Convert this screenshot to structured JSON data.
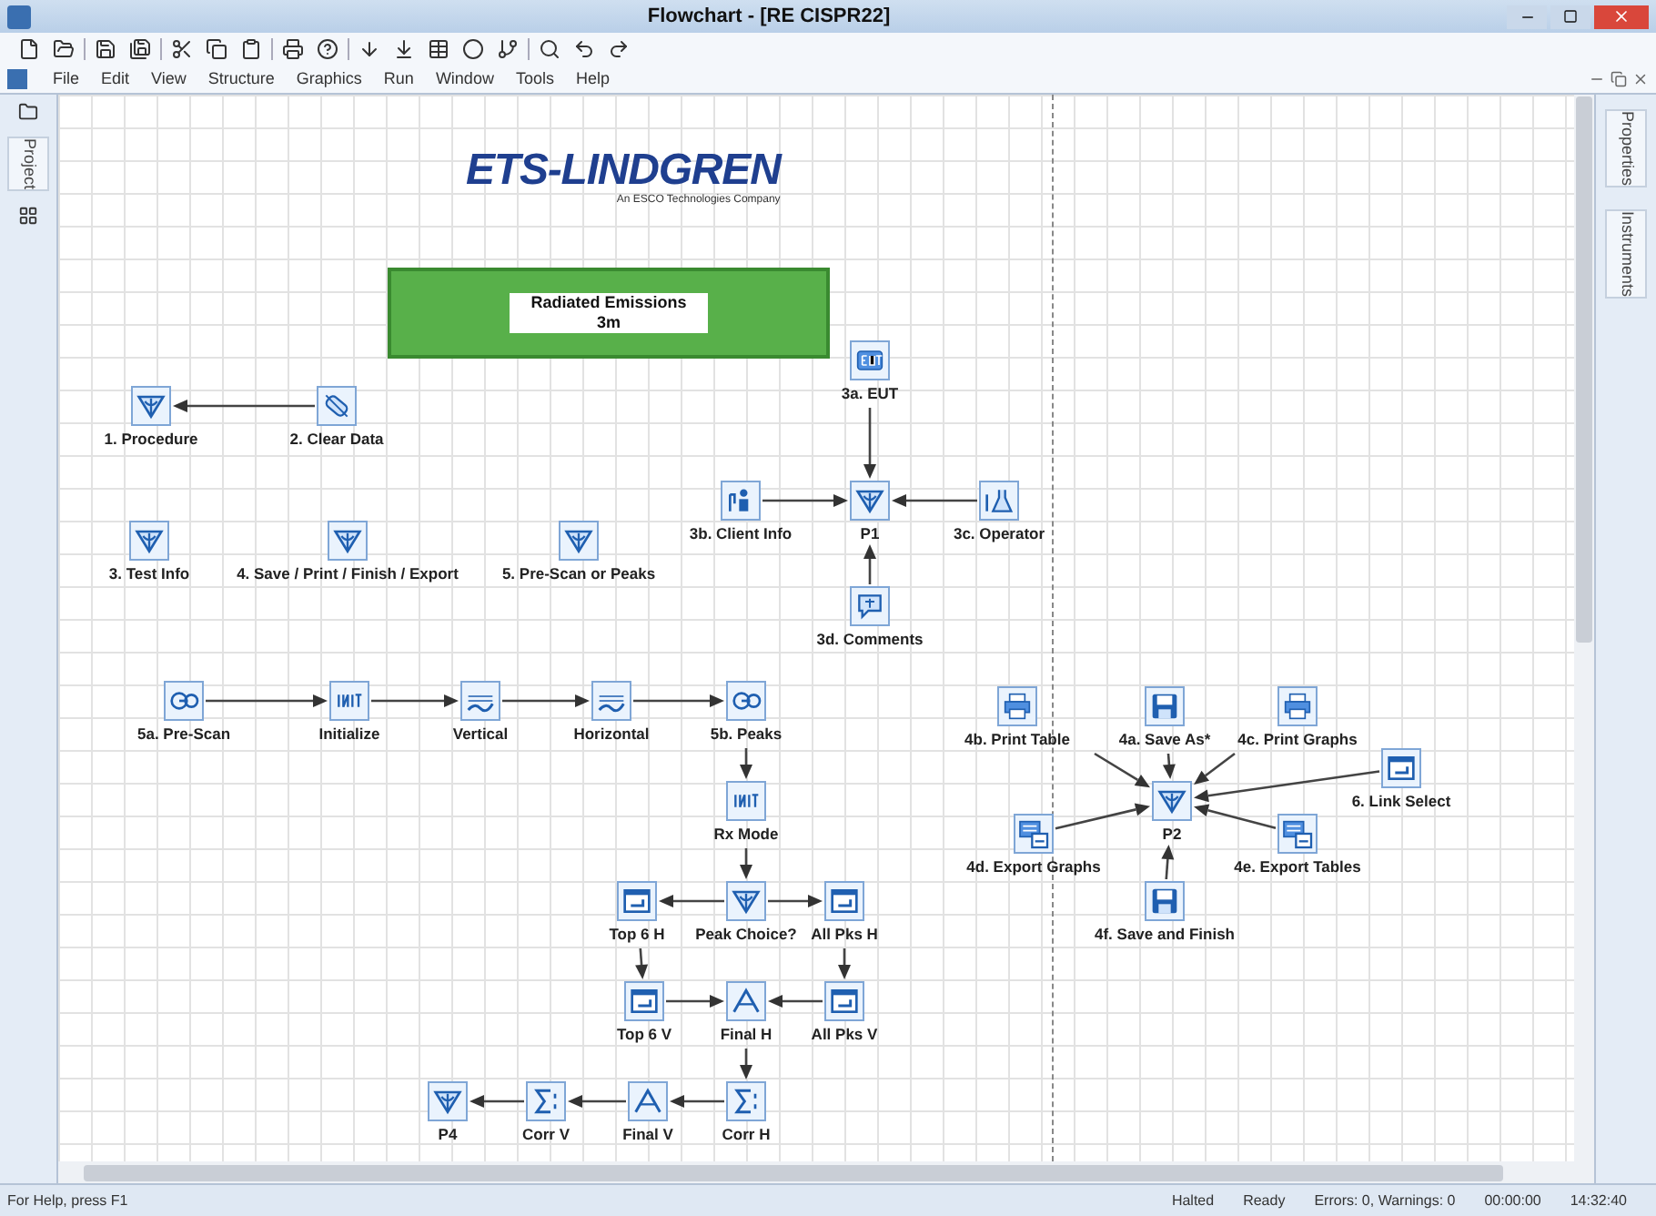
{
  "window": {
    "title": "Flowchart - [RE CISPR22]"
  },
  "menu": [
    {
      "label": "File"
    },
    {
      "label": "Edit"
    },
    {
      "label": "View"
    },
    {
      "label": "Structure"
    },
    {
      "label": "Graphics"
    },
    {
      "label": "Run"
    },
    {
      "label": "Window"
    },
    {
      "label": "Tools"
    },
    {
      "label": "Help"
    }
  ],
  "left_panel": {
    "tab": "Project"
  },
  "right_panel": {
    "tabs": [
      {
        "label": "Properties"
      },
      {
        "label": "Instruments"
      }
    ]
  },
  "canvas": {
    "logo": {
      "name": "ETS-LINDGREN",
      "tagline": "An ESCO Technologies Company"
    },
    "banner": {
      "title": "Radiated Emissions",
      "subtitle": "3m"
    },
    "nodes": [
      {
        "label": "1. Procedure",
        "kind": "decision"
      },
      {
        "label": "2. Clear Data",
        "kind": "clear"
      },
      {
        "label": "3a. EUT",
        "kind": "eut"
      },
      {
        "label": "3b. Client Info",
        "kind": "person"
      },
      {
        "label": "P1",
        "kind": "decision"
      },
      {
        "label": "3c. Operator",
        "kind": "flask"
      },
      {
        "label": "3d. Comments",
        "kind": "comments"
      },
      {
        "label": "3. Test Info",
        "kind": "decision"
      },
      {
        "label": "4. Save / Print / Finish / Export",
        "kind": "decision"
      },
      {
        "label": "5. Pre-Scan or Peaks",
        "kind": "decision"
      },
      {
        "label": "5a. Pre-Scan",
        "kind": "go"
      },
      {
        "label": "Initialize",
        "kind": "init"
      },
      {
        "label": "Vertical",
        "kind": "scan"
      },
      {
        "label": "Horizontal",
        "kind": "scan"
      },
      {
        "label": "5b. Peaks",
        "kind": "go"
      },
      {
        "label": "Rx Mode",
        "kind": "init"
      },
      {
        "label": "Top 6 H",
        "kind": "window"
      },
      {
        "label": "Peak Choice?",
        "kind": "decision"
      },
      {
        "label": "All Pks H",
        "kind": "window"
      },
      {
        "label": "Top 6 V",
        "kind": "window"
      },
      {
        "label": "Final H",
        "kind": "peak"
      },
      {
        "label": "All Pks V",
        "kind": "window"
      },
      {
        "label": "P4",
        "kind": "decision"
      },
      {
        "label": "Corr V",
        "kind": "sum"
      },
      {
        "label": "Final V",
        "kind": "peak"
      },
      {
        "label": "Corr H",
        "kind": "sum"
      },
      {
        "label": "4b. Print Table",
        "kind": "printer"
      },
      {
        "label": "4a. Save As*",
        "kind": "save"
      },
      {
        "label": "4c. Print Graphs",
        "kind": "printer"
      },
      {
        "label": "6. Link Select",
        "kind": "window"
      },
      {
        "label": "4d. Export Graphs",
        "kind": "export"
      },
      {
        "label": "P2",
        "kind": "decision"
      },
      {
        "label": "4e. Export Tables",
        "kind": "export"
      },
      {
        "label": "4f. Save and Finish",
        "kind": "save"
      }
    ]
  },
  "status_bar": {
    "help": "For Help, press F1",
    "items": [
      "Halted",
      "Ready",
      "Errors: 0, Warnings: 0",
      "00:00:00",
      "14:32:40"
    ]
  }
}
